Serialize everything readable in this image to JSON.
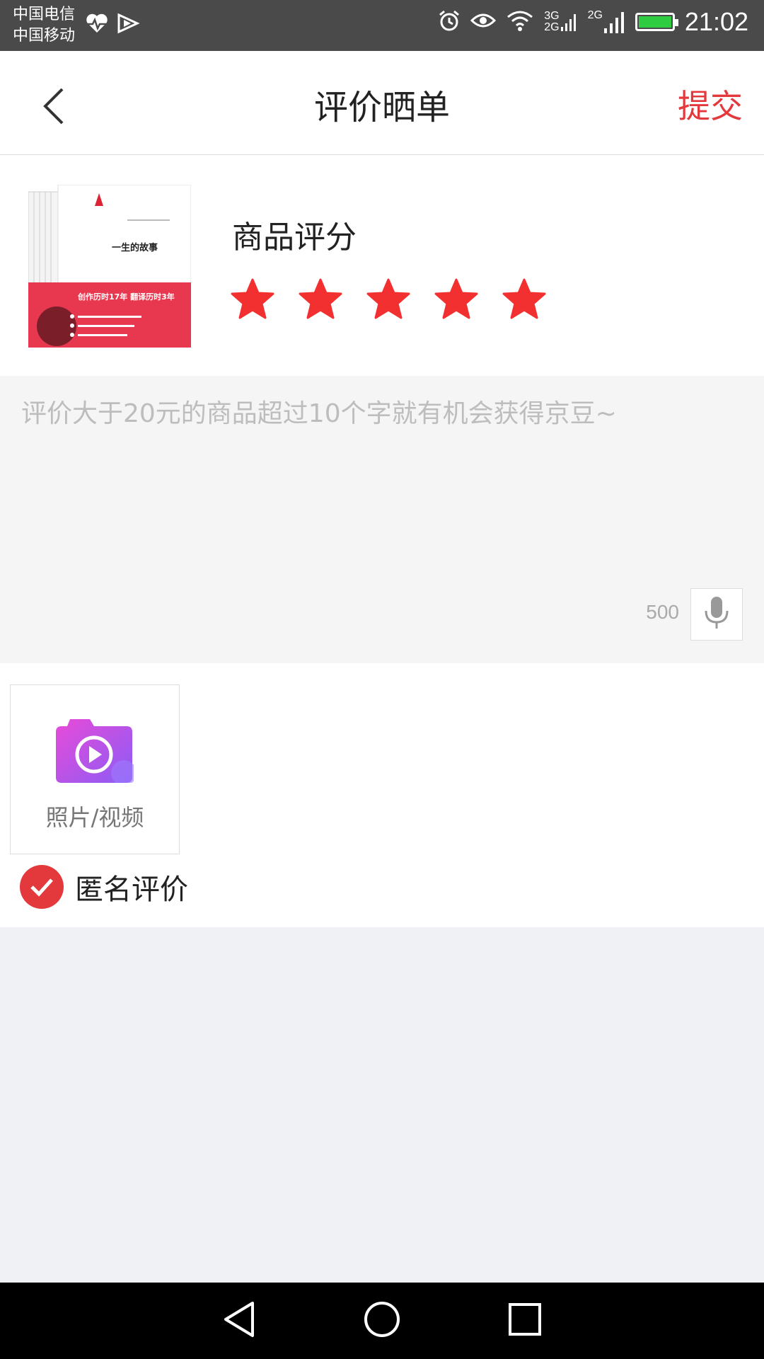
{
  "status_bar": {
    "carrier1": "中国电信",
    "carrier2": "中国移动",
    "net1": "3G",
    "net2": "2G",
    "net3": "2G",
    "time": "21:02"
  },
  "header": {
    "title": "评价晒单",
    "submit_label": "提交"
  },
  "product": {
    "rating_label": "商品评分",
    "rating_value": 5,
    "rating_max": 5,
    "book_title": "一生的故事",
    "book_band_text": "创作历时17年  翻译历时3年"
  },
  "review": {
    "placeholder": "评价大于20元的商品超过10个字就有机会获得京豆~",
    "char_count": "500"
  },
  "media": {
    "upload_label": "照片/视频"
  },
  "anonymous": {
    "label": "匿名评价",
    "checked": true
  },
  "colors": {
    "accent": "#e4393c",
    "statusbar": "#4a4a4a",
    "page_bg": "#f0f1f5"
  },
  "icons": [
    "heart-pulse-icon",
    "play-badge-icon",
    "alarm-icon",
    "eye-icon",
    "wifi-icon",
    "signal-icon",
    "battery-icon",
    "back-icon",
    "star-icon",
    "mic-icon",
    "camera-video-icon",
    "check-icon",
    "nav-back-icon",
    "nav-home-icon",
    "nav-recents-icon"
  ]
}
